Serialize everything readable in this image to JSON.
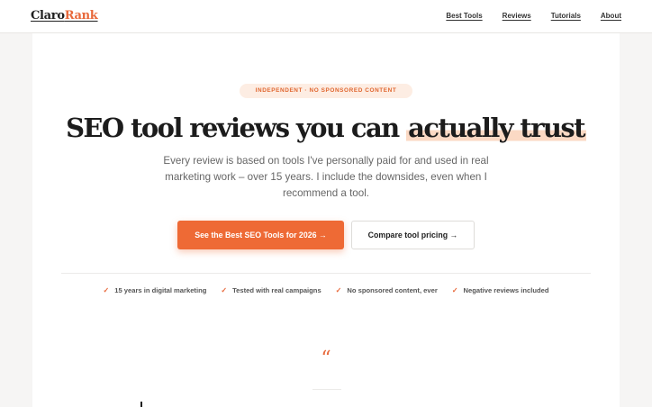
{
  "brand": {
    "part1": "Claro",
    "part2": "Rank",
    "accent_color": "#e8683a"
  },
  "nav": {
    "items": [
      {
        "label": "Best Tools"
      },
      {
        "label": "Reviews"
      },
      {
        "label": "Tutorials"
      },
      {
        "label": "About"
      }
    ]
  },
  "hero": {
    "badge": "INDEPENDENT · NO SPONSORED CONTENT",
    "headline_main": "SEO tool reviews you can ",
    "headline_highlight": "actually trust",
    "subtitle": "Every review is based on tools I've personally paid for and used in real marketing work – over 15 years. I include the downsides, even when I recommend a tool.",
    "cta_primary": "See the Best SEO Tools for 2026 →",
    "cta_secondary": "Compare tool pricing →"
  },
  "trust": {
    "items": [
      {
        "icon": "check-icon",
        "label": "15 years in digital marketing"
      },
      {
        "icon": "check-icon",
        "label": "Tested with real campaigns"
      },
      {
        "icon": "check-icon",
        "label": "No sponsored content, ever"
      },
      {
        "icon": "check-icon",
        "label": "Negative reviews included"
      }
    ]
  },
  "testimonial": {
    "quote_mark": "“"
  }
}
